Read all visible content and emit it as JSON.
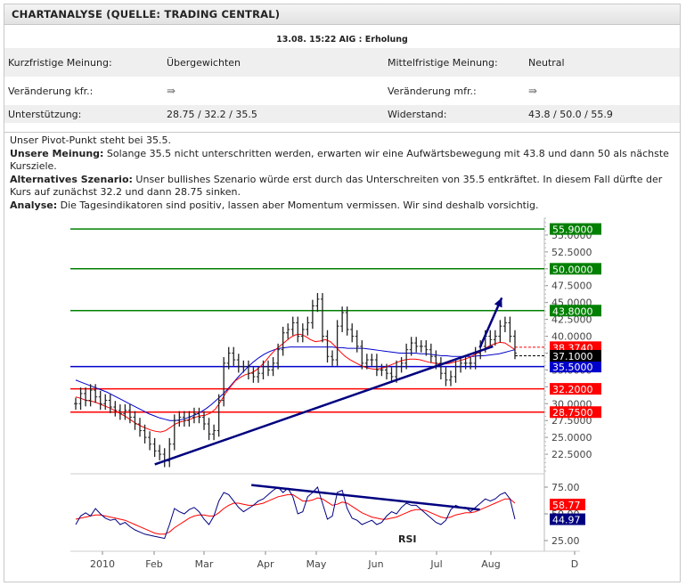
{
  "header": {
    "title": "CHARTANALYSE (QUELLE: TRADING CENTRAL)"
  },
  "subheader": "13.08. 15:22 AIG : Erholung",
  "info": {
    "kurz_label": "Kurzfristige Meinung:",
    "kurz_value": "Übergewichten",
    "mittel_label": "Mittelfristige Meinung:",
    "mittel_value": "Neutral",
    "veraenderung_kfr_label": "Veränderung kfr.:",
    "veraenderung_kfr_value": "⇛",
    "veraenderung_mfr_label": "Veränderung mfr.:",
    "veraenderung_mfr_value": "⇛",
    "unterstuetzung_label": "Unterstützung:",
    "unterstuetzung_value": "28.75 / 32.2 / 35.5",
    "widerstand_label": "Widerstand:",
    "widerstand_value": "43.8 / 50.0 / 55.9"
  },
  "analysis": {
    "pivot": "Unser Pivot-Punkt steht bei 35.5.",
    "meinung_label": "Unsere Meinung:",
    "meinung_text": " Solange 35.5 nicht unterschritten werden, erwarten wir eine Aufwärtsbewegung mit 43.8 und dann 50 als nächste Kursziele.",
    "alternativ_label": "Alternatives Szenario:",
    "alternativ_text": " Unser bullishes Szenario würde erst durch das Unterschreiten von 35.5 entkräftet. In diesem Fall dürfte der Kurs auf zunächst 32.2 und dann 28.75 sinken.",
    "analyse_label": "Analyse:",
    "analyse_text": " Die Tagesindikatoren sind positiv, lassen aber Momentum vermissen. Wir sind deshalb vorsichtig."
  },
  "chart_data": {
    "type": "line",
    "subtype": "ohlc-bar",
    "price_axis": {
      "ylim": [
        20.0,
        57.5
      ],
      "ticks": [
        "55.0000",
        "52.5000",
        "50.0000",
        "47.5000",
        "45.0000",
        "42.5000",
        "40.0000",
        "37.5000",
        "35.0000",
        "32.5000",
        "30.0000",
        "27.5000",
        "25.0000",
        "22.5000"
      ],
      "tick_values": [
        55.0,
        52.5,
        50.0,
        47.5,
        45.0,
        42.5,
        40.0,
        37.5,
        35.0,
        32.5,
        30.0,
        27.5,
        25.0,
        22.5
      ]
    },
    "x_labels": [
      "2010",
      "Feb",
      "Mar",
      "Apr",
      "May",
      "Jun",
      "Jul",
      "Aug",
      "D"
    ],
    "levels": [
      {
        "value": 55.9,
        "label": "55.9000",
        "color": "#008000"
      },
      {
        "value": 50.0,
        "label": "50.0000",
        "color": "#008000"
      },
      {
        "value": 43.8,
        "label": "43.8000",
        "color": "#008000"
      },
      {
        "value": 35.5,
        "label": "35.5000",
        "color": "#0000cc"
      },
      {
        "value": 32.2,
        "label": "32.2000",
        "color": "#ff0000"
      },
      {
        "value": 28.75,
        "label": "28.7500",
        "color": "#ff0000"
      }
    ],
    "price_badges": [
      {
        "value": 38.374,
        "label": "38.3740",
        "color": "#ff0000"
      },
      {
        "value": 37.1,
        "label": "37.1000",
        "color": "#000000"
      }
    ],
    "price_close": [
      30.0,
      31.5,
      30.5,
      32.0,
      31.0,
      30.0,
      30.5,
      29.5,
      29.0,
      28.5,
      29.0,
      28.0,
      27.0,
      26.0,
      25.0,
      24.0,
      23.0,
      22.5,
      21.5,
      24.0,
      27.5,
      28.0,
      27.5,
      28.0,
      28.5,
      28.0,
      27.0,
      25.5,
      26.0,
      30.5,
      36.0,
      37.5,
      36.5,
      35.5,
      35.5,
      34.5,
      34.0,
      34.5,
      35.5,
      35.0,
      36.0,
      38.0,
      40.5,
      41.0,
      42.0,
      40.0,
      41.0,
      42.0,
      44.5,
      45.5,
      40.0,
      37.0,
      36.5,
      41.5,
      43.5,
      41.0,
      40.0,
      38.5,
      36.0,
      36.5,
      36.5,
      35.0,
      35.0,
      34.5,
      34.0,
      35.5,
      36.0,
      38.0,
      39.0,
      38.5,
      38.5,
      38.0,
      37.0,
      36.0,
      34.5,
      33.5,
      34.0,
      35.5,
      36.0,
      36.0,
      36.0,
      37.5,
      38.5,
      40.0,
      39.5,
      40.0,
      41.5,
      42.0,
      40.0,
      37.5
    ],
    "ma_red": [
      31.0,
      30.8,
      30.5,
      30.4,
      30.2,
      29.9,
      29.6,
      29.3,
      28.9,
      28.5,
      28.1,
      27.6,
      27.1,
      26.7,
      26.4,
      26.1,
      25.9,
      25.8,
      26.0,
      26.5,
      27.0,
      27.3,
      27.5,
      27.7,
      28.0,
      28.2,
      28.3,
      28.6,
      29.2,
      30.3,
      31.5,
      32.5,
      33.4,
      33.9,
      34.3,
      34.5,
      34.9,
      35.5,
      36.3,
      37.2,
      38.0,
      38.6,
      39.2,
      39.8,
      40.2,
      40.3,
      40.0,
      39.5,
      39.2,
      39.3,
      39.5,
      39.2,
      38.5,
      37.7,
      37.0,
      36.5,
      36.1,
      35.7,
      35.4,
      35.2,
      35.1,
      35.2,
      35.4,
      35.7,
      36.0,
      36.3,
      36.5,
      36.6,
      36.6,
      36.5,
      36.3,
      36.1,
      36.0,
      35.9,
      35.9,
      36.0,
      36.2,
      36.4,
      36.6,
      36.9,
      37.3,
      37.7,
      38.2,
      38.6,
      38.9,
      39.1,
      39.0,
      38.5,
      38.0
    ],
    "ma_blue": [
      33.5,
      33.2,
      32.9,
      32.6,
      32.3,
      32.0,
      31.7,
      31.3,
      30.9,
      30.5,
      30.1,
      29.7,
      29.3,
      28.9,
      28.5,
      28.2,
      27.9,
      27.7,
      27.5,
      27.5,
      27.6,
      27.8,
      28.1,
      28.4,
      28.8,
      29.3,
      29.9,
      30.6,
      31.3,
      32.1,
      33.0,
      33.9,
      34.7,
      35.5,
      36.2,
      36.8,
      37.3,
      37.7,
      38.0,
      38.2,
      38.3,
      38.4,
      38.4,
      38.4,
      38.4,
      38.4,
      38.4,
      38.4,
      38.4,
      38.4,
      38.3,
      38.3,
      38.2,
      38.2,
      38.2,
      38.2,
      38.1,
      38.0,
      37.9,
      37.8,
      37.7,
      37.6,
      37.5,
      37.5,
      37.5,
      37.5,
      37.4,
      37.4,
      37.3,
      37.2,
      37.1,
      37.1,
      37.0,
      37.0,
      37.0,
      37.0,
      37.0,
      37.1,
      37.1,
      37.2,
      37.3,
      37.4,
      37.6,
      37.8,
      38.0
    ],
    "trendline": {
      "from": [
        0.18,
        21.0
      ],
      "to": [
        0.95,
        38.5
      ]
    },
    "projection_arrow": {
      "from": [
        0.92,
        38.3
      ],
      "to": [
        0.97,
        45.7
      ]
    },
    "rsi": {
      "label": "RSI",
      "ylim": [
        20,
        80
      ],
      "ticks": [
        "75.00",
        "50.00",
        "25.00"
      ],
      "tick_values": [
        75,
        50,
        25
      ],
      "badges": [
        {
          "value": 58.77,
          "label": "58.77",
          "color": "#ff0000"
        },
        {
          "value": 44.97,
          "label": "44.97",
          "color": "#000080"
        }
      ],
      "values": [
        40,
        48,
        51,
        48,
        55,
        50,
        46,
        44,
        45,
        40,
        42,
        38,
        35,
        33,
        31,
        30,
        29,
        28,
        27,
        40,
        55,
        52,
        50,
        54,
        56,
        52,
        45,
        40,
        48,
        62,
        70,
        68,
        62,
        56,
        52,
        55,
        58,
        62,
        64,
        68,
        72,
        75,
        70,
        74,
        66,
        50,
        52,
        66,
        70,
        75,
        60,
        45,
        48,
        70,
        72,
        55,
        46,
        44,
        40,
        42,
        44,
        40,
        42,
        48,
        52,
        50,
        56,
        60,
        58,
        58,
        54,
        50,
        46,
        42,
        40,
        44,
        54,
        58,
        56,
        56,
        52,
        56,
        60,
        64,
        62,
        64,
        68,
        70,
        64,
        45
      ],
      "signal": [
        45,
        46,
        47,
        48,
        49,
        49,
        48,
        47,
        46,
        45,
        44,
        42,
        40,
        38,
        36,
        34,
        32,
        31,
        31,
        33,
        37,
        40,
        43,
        46,
        48,
        49,
        49,
        48,
        48,
        51,
        55,
        58,
        60,
        60,
        59,
        58,
        58,
        59,
        60,
        62,
        64,
        66,
        67,
        68,
        68,
        65,
        62,
        62,
        63,
        65,
        64,
        61,
        58,
        59,
        61,
        60,
        57,
        54,
        51,
        49,
        47,
        46,
        45,
        45,
        46,
        47,
        49,
        51,
        53,
        54,
        54,
        53,
        51,
        49,
        47,
        46,
        47,
        49,
        50,
        51,
        51,
        52,
        54,
        56,
        58,
        60,
        62,
        64,
        64,
        60
      ],
      "divergence_line": {
        "from": [
          0.4,
          77.0
        ],
        "to": [
          0.92,
          54.0
        ]
      }
    }
  }
}
